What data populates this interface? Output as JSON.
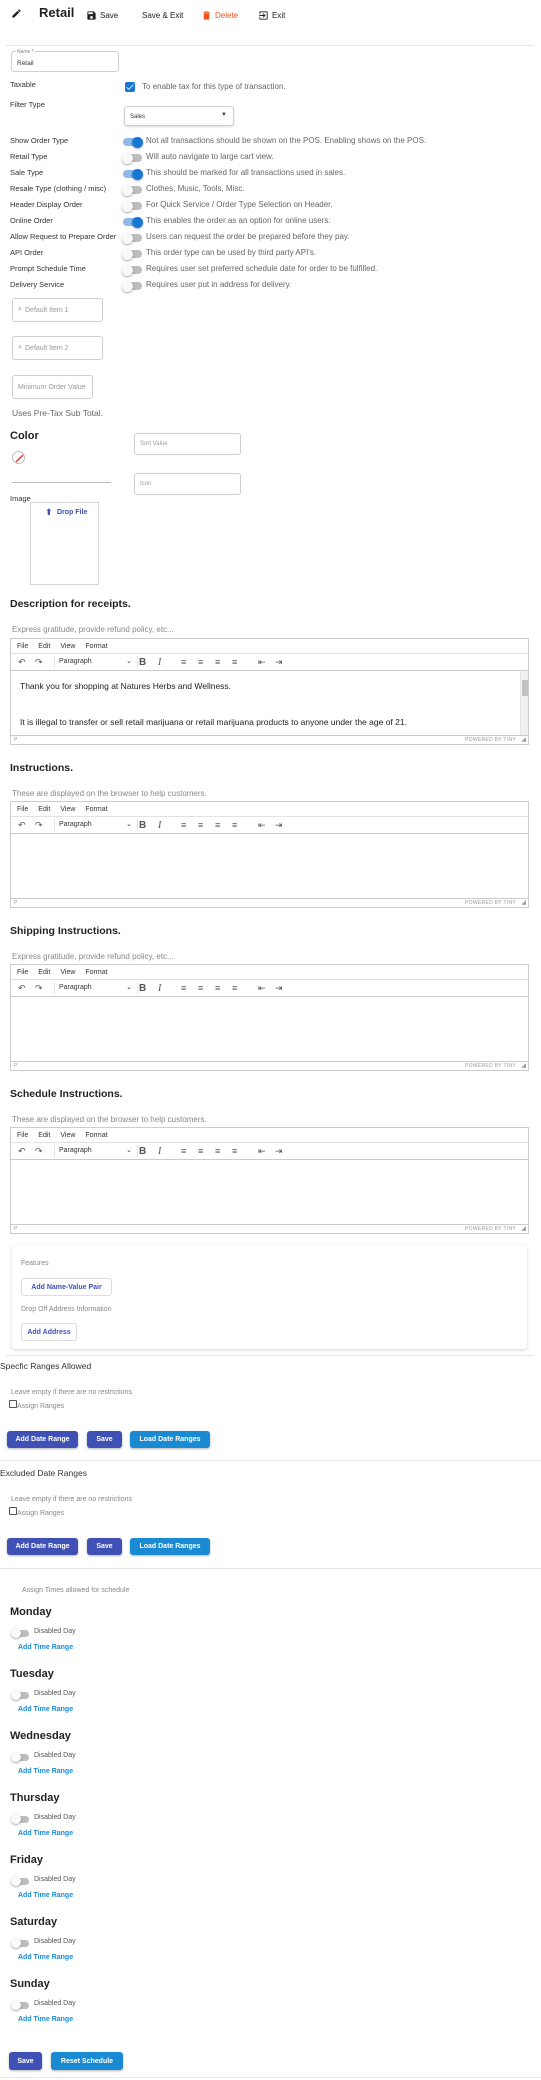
{
  "toolbar": {
    "title": "Retail",
    "save": "Save",
    "save_exit": "Save & Exit",
    "delete": "Delete",
    "exit": "Exit"
  },
  "form": {
    "name_label": "Name *",
    "name_value": "Retail",
    "taxable_label": "Taxable",
    "taxable_text": "To enable tax for this type of transaction.",
    "filter_type_label": "Filter Type",
    "filter_type_value": "Sales",
    "settings": [
      {
        "label": "Show Order Type",
        "text": "Not all transactions should be shown on the POS. Enabling shows on the POS.",
        "on": true
      },
      {
        "label": "Retail Type",
        "text": "Will auto navigate to large cart view.",
        "on": false
      },
      {
        "label": "Sale Type",
        "text": "This should be marked for all transactions used in sales.",
        "on": true
      },
      {
        "label": "Resale Type (clothing / misc)",
        "text": "Clothes, Music, Tools, Misc.",
        "on": false
      },
      {
        "label": "Header Display Order",
        "text": "For Quick Service / Order Type Selection on Header.",
        "on": false
      },
      {
        "label": "Online Order",
        "text": "This enables the order as an option for online users.",
        "on": true
      },
      {
        "label": "Allow Request to Prepare Order",
        "text": "Users can request the order be prepared before they pay.",
        "on": false
      },
      {
        "label": "API Order",
        "text": "This order type can be used by third party API's.",
        "on": false
      },
      {
        "label": "Prompt Schedule Time",
        "text": "Requires user set preferred schedule date for order to be fulfilled.",
        "on": false
      },
      {
        "label": "Delivery Service",
        "text": "Requires user put in address for delivery.",
        "on": false
      }
    ],
    "default_item_1": "Default Item 1",
    "default_item_2": "Default Item 2",
    "min_order_value": "Minimum Order Value",
    "pre_tax_text": "Uses Pre-Tax Sub Total.",
    "color_label": "Color",
    "sort_value": "Sort Value",
    "icon": "Icon",
    "image_label": "Image",
    "drop_file": "Drop File"
  },
  "editors": {
    "menu": [
      "File",
      "Edit",
      "View",
      "Format"
    ],
    "paragraph": "Paragraph",
    "status_p": "P",
    "powered": "POWERED BY TINY",
    "receipts_title": "Description for receipts.",
    "receipts_help": "Express gratitude, provide refund policy, etc...",
    "receipts_line1": "Thank you for shopping at Natures Herbs and Wellness.",
    "receipts_line2": "It is illegal to transfer or sell retail marijuana or retail marijuana products to anyone under the age of 21.",
    "instructions_title": "Instructions.",
    "instructions_help": "These are displayed on the browser to help customers.",
    "shipping_title": "Shipping Instructions.",
    "shipping_help": "Express gratitude, provide refund policy, etc...",
    "schedule_title": "Schedule Instructions.",
    "schedule_help": "These are displayed on the browser to help customers."
  },
  "features": {
    "label": "Features",
    "add_pair": "Add Name-Value Pair",
    "dropoff_label": "Drop Off Address Information",
    "add_address": "Add Address"
  },
  "ranges": {
    "specific_title": "Specfic Ranges Allowed",
    "excluded_title": "Excluded Date Ranges",
    "empty_help": "Leave empty if there are no restrictions",
    "assign": "Assign Ranges",
    "add_date_range": "Add Date Range",
    "save": "Save",
    "load": "Load Date Ranges"
  },
  "schedule": {
    "help": "Assign Times allowed for schedule",
    "days": [
      "Monday",
      "Tuesday",
      "Wednesday",
      "Thursday",
      "Friday",
      "Saturday",
      "Sunday"
    ],
    "disabled": "Disabled Day",
    "add_time": "Add Time Range",
    "save": "Save",
    "reset": "Reset Schedule"
  },
  "colors": {
    "primary": "#3f51b5",
    "accent": "#1a8bd3",
    "delete": "#f4511e",
    "toggle_on": "#1976d2"
  }
}
